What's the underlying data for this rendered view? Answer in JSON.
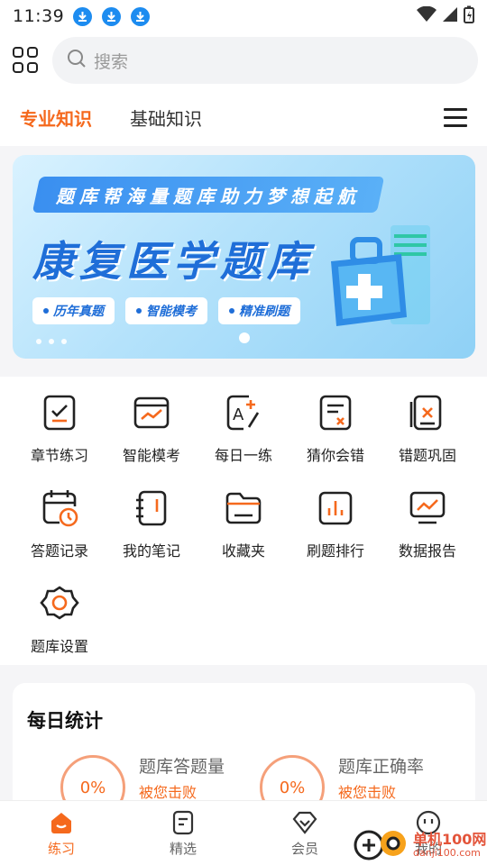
{
  "status_bar": {
    "time": "11:39"
  },
  "search": {
    "placeholder": "搜索"
  },
  "tabs": [
    {
      "label": "专业知识",
      "active": true
    },
    {
      "label": "基础知识",
      "active": false
    }
  ],
  "banner": {
    "ribbon": "题库帮海量题库助力梦想起航",
    "title": "康复医学题库",
    "tags": [
      "历年真题",
      "智能模考",
      "精准刷题"
    ]
  },
  "features": [
    {
      "label": "章节练习",
      "icon": "checklist-icon"
    },
    {
      "label": "智能模考",
      "icon": "chart-card-icon"
    },
    {
      "label": "每日一练",
      "icon": "grade-pen-icon"
    },
    {
      "label": "猜你会错",
      "icon": "doc-x-icon"
    },
    {
      "label": "错题巩固",
      "icon": "folder-x-icon"
    },
    {
      "label": "答题记录",
      "icon": "calendar-clock-icon"
    },
    {
      "label": "我的笔记",
      "icon": "notebook-icon"
    },
    {
      "label": "收藏夹",
      "icon": "folder-icon"
    },
    {
      "label": "刷题排行",
      "icon": "bar-rank-icon"
    },
    {
      "label": "数据报告",
      "icon": "monitor-chart-icon"
    },
    {
      "label": "题库设置",
      "icon": "settings-icon"
    }
  ],
  "daily_stats": {
    "title": "每日统计",
    "items": [
      {
        "value": "0%",
        "label": "题库答题量",
        "sub": "被您击败"
      },
      {
        "value": "0%",
        "label": "题库正确率",
        "sub": "被您击败"
      }
    ]
  },
  "bottom_nav": [
    {
      "label": "练习",
      "active": true
    },
    {
      "label": "精选",
      "active": false
    },
    {
      "label": "会员",
      "active": false
    },
    {
      "label": "我的",
      "active": false
    }
  ],
  "watermark": {
    "line1": "单机100网",
    "line2": "danji100.com"
  },
  "colors": {
    "accent": "#f5691d",
    "banner_blue": "#1f6ed8"
  }
}
